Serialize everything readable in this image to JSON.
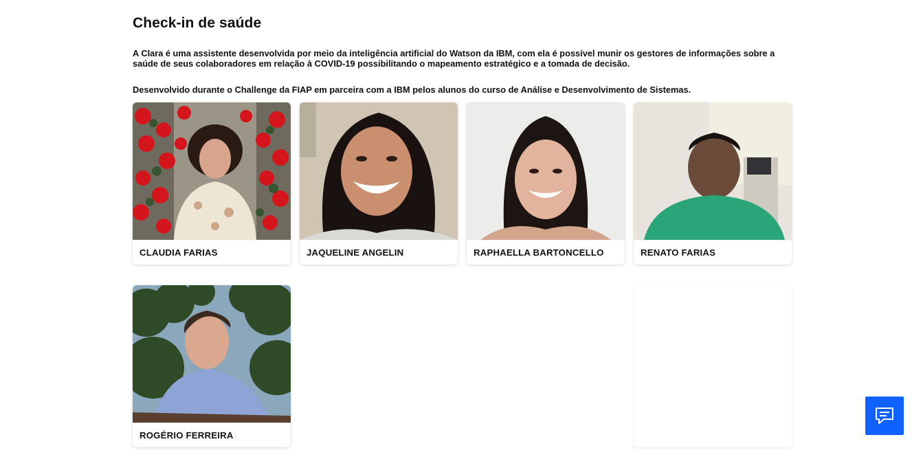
{
  "page": {
    "title": "Check-in de saúde",
    "intro": "A Clara é uma assistente desenvolvida por meio da inteligência artificial do Watson da IBM, com ela é possível munir os gestores de informações sobre a saúde de seus colaboradores em relação à COVID-19 possibilitando o mapeamento estratégico e a tomada de decisão.",
    "developed_by": "Desenvolvido durante o Challenge da FIAP em parceira com a IBM pelos alunos do curso de Análise e Desenvolvimento de Sistemas."
  },
  "team": [
    {
      "name": "CLAUDIA FARIAS"
    },
    {
      "name": "JAQUELINE ANGELIN"
    },
    {
      "name": "RAPHAELLA BARTONCELLO"
    },
    {
      "name": "RENATO FARIAS"
    },
    {
      "name": "ROGÉRIO FERREIRA"
    }
  ],
  "chat_widget": {
    "icon": "chat-icon",
    "color": "#0f62fe"
  }
}
